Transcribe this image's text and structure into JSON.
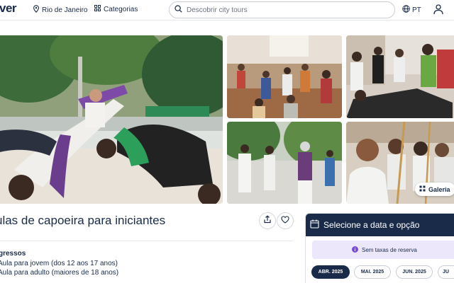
{
  "header": {
    "logo_text": "ver",
    "location": "Rio de Janeiro",
    "location_icon": "map-pin-icon",
    "categories": "Categorias",
    "categories_icon": "grid-icon",
    "search_placeholder": "Descobrir city tours",
    "language": "PT",
    "language_icon": "globe-icon",
    "user_icon": "user-icon"
  },
  "gallery": {
    "button_label": "Galeria",
    "button_icon": "grid-icon"
  },
  "activity": {
    "title": "ulas de capoeira para iniciantes",
    "share_icon": "share-icon",
    "wishlist_icon": "heart-icon"
  },
  "tickets": {
    "heading": "gressos",
    "items": [
      "Aula para jovem (dos 12 aos 17 anos)",
      "Aula para adulto (maiores de 18 anos)"
    ]
  },
  "booking": {
    "title": "Selecione a data e opção",
    "title_icon": "calendar-icon",
    "notice": "Sem taxas de reserva",
    "notice_icon": "info-icon",
    "months": [
      "ABR. 2025",
      "MAI. 2025",
      "JUN. 2025",
      "JU"
    ],
    "selected_month": "ABR. 2025"
  },
  "colors": {
    "brand_navy": "#1a2b49",
    "notice_bg": "#ede7fb",
    "accent_purple": "#7b48e0"
  }
}
